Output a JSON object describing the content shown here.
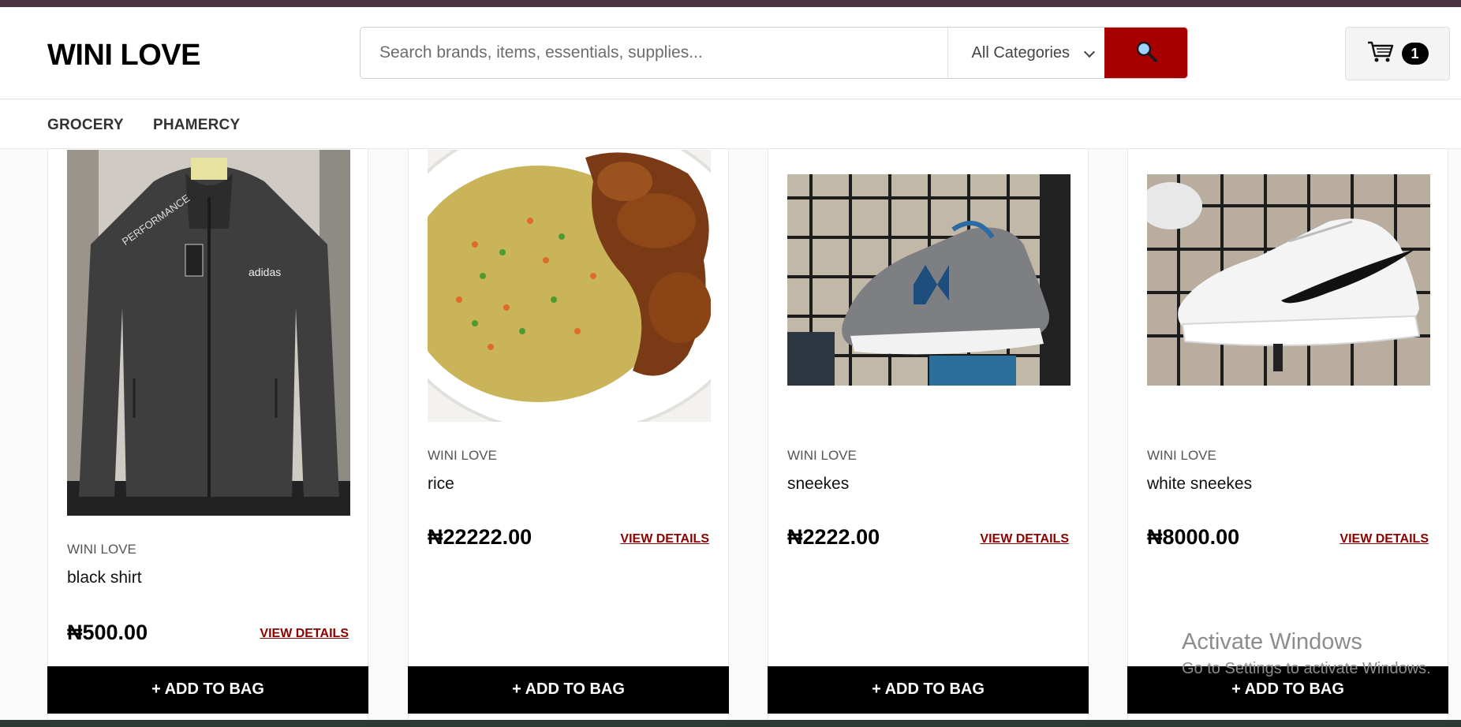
{
  "brand": "WINI LOVE",
  "search": {
    "placeholder": "Search brands, items, essentials, supplies...",
    "category_selected": "All Categories"
  },
  "cart": {
    "count": "1"
  },
  "nav": {
    "items": [
      "GROCERY",
      "PHAMERCY"
    ]
  },
  "products": [
    {
      "vendor": "WINI LOVE",
      "name": "black shirt",
      "price": "₦500.00",
      "details_label": "VIEW DETAILS",
      "add_label": "+ ADD TO BAG",
      "image": "black-jacket-photo"
    },
    {
      "vendor": "WINI LOVE",
      "name": "rice",
      "price": "₦22222.00",
      "details_label": "VIEW DETAILS",
      "add_label": "+ ADD TO BAG",
      "image": "fried-rice-photo"
    },
    {
      "vendor": "WINI LOVE",
      "name": "sneekes",
      "price": "₦2222.00",
      "details_label": "VIEW DETAILS",
      "add_label": "+ ADD TO BAG",
      "image": "grey-sneaker-photo"
    },
    {
      "vendor": "WINI LOVE",
      "name": "white sneekes",
      "price": "₦8000.00",
      "details_label": "VIEW DETAILS",
      "add_label": "+ ADD TO BAG",
      "image": "white-sneaker-photo"
    }
  ],
  "watermark": {
    "title": "Activate Windows",
    "subtitle": "Go to Settings to activate Windows."
  },
  "colors": {
    "accent": "#a80000",
    "details": "#8b0000",
    "topbar": "#4b3241"
  }
}
